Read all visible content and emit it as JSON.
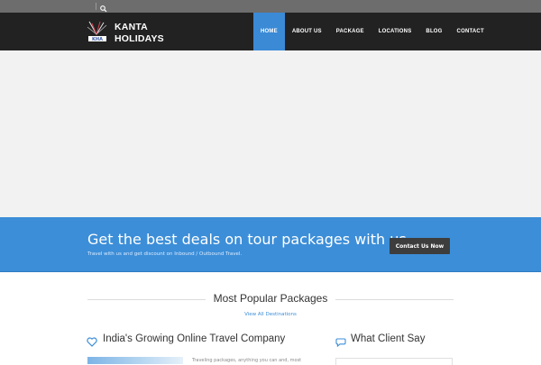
{
  "brand": {
    "line1": "KANTA",
    "line2": "HOLIDAYS",
    "logo_text": "KHA"
  },
  "icons": {
    "search": "search-icon",
    "heart": "heart-icon",
    "chat": "chat-bubble-icon",
    "logo": "kanta-logo"
  },
  "colors": {
    "accent": "#3a8ad6",
    "navbar": "#222222",
    "topbar": "#6d6d6d",
    "cta_band": "#3c8ed8",
    "cta_button": "#3d3d3d"
  },
  "nav": {
    "items": [
      {
        "label": "HOME",
        "active": true
      },
      {
        "label": "ABOUT US"
      },
      {
        "label": "PACKAGE"
      },
      {
        "label": "LOCATIONS"
      },
      {
        "label": "BLOG"
      },
      {
        "label": "CONTACT"
      }
    ]
  },
  "cta": {
    "title": "Get the best deals on tour packages with us.",
    "subtitle": "Travel with us and get discount on Inbound / Outbound Travel.",
    "button": "Contact Us Now"
  },
  "popular": {
    "title": "Most Popular Packages",
    "link": "View All Destinations"
  },
  "columns": {
    "left_title": "India's Growing Online Travel Company",
    "left_snippet": "Traveling packages, anything you can and, most",
    "right_title": "What Client Say"
  }
}
